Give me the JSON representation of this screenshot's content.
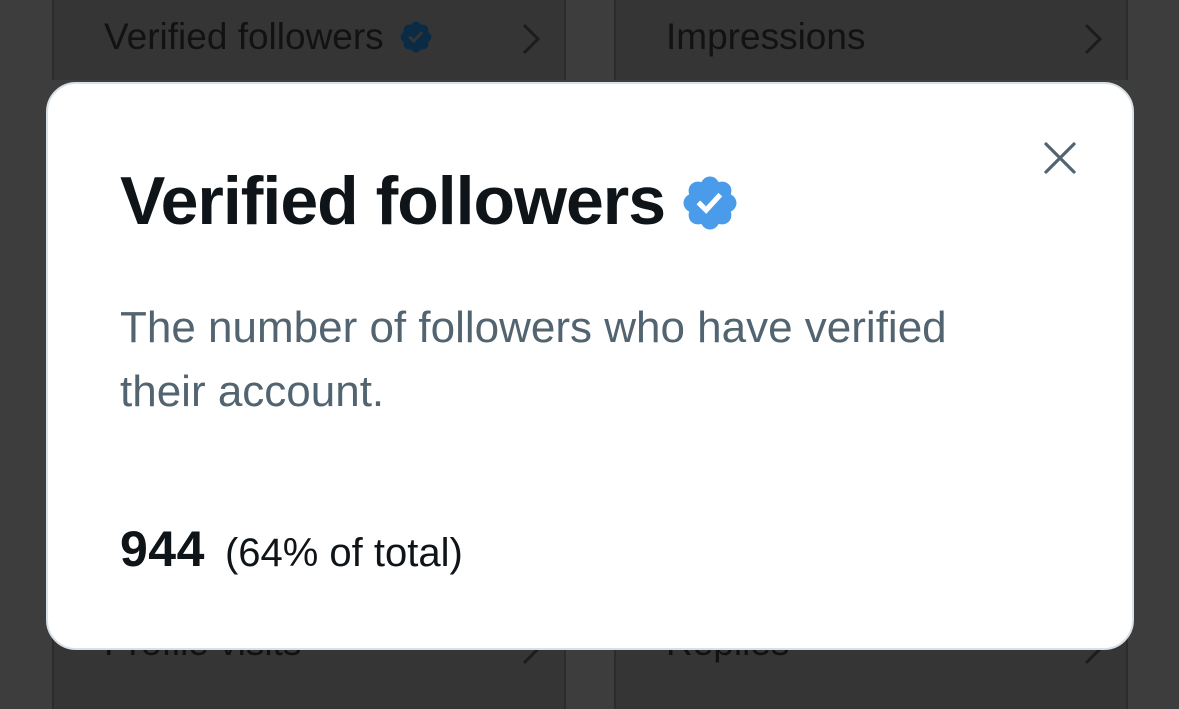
{
  "background": {
    "tiles": [
      {
        "label": "Verified followers",
        "has_badge": true
      },
      {
        "label": "Impressions",
        "has_badge": false
      },
      {
        "label": "Profile visits",
        "has_badge": false
      },
      {
        "label": "Replies",
        "has_badge": false
      }
    ]
  },
  "modal": {
    "title": "Verified followers",
    "description": "The number of followers who have verified their account.",
    "stat_value": "944",
    "stat_detail": "(64% of total)",
    "close_icon": "close-icon",
    "badge_icon": "verified-badge-icon"
  },
  "colors": {
    "badge_blue": "#1d9bf0",
    "title": "#0f1419",
    "secondary_text": "#536471",
    "overlay": "#3d3d3d"
  }
}
